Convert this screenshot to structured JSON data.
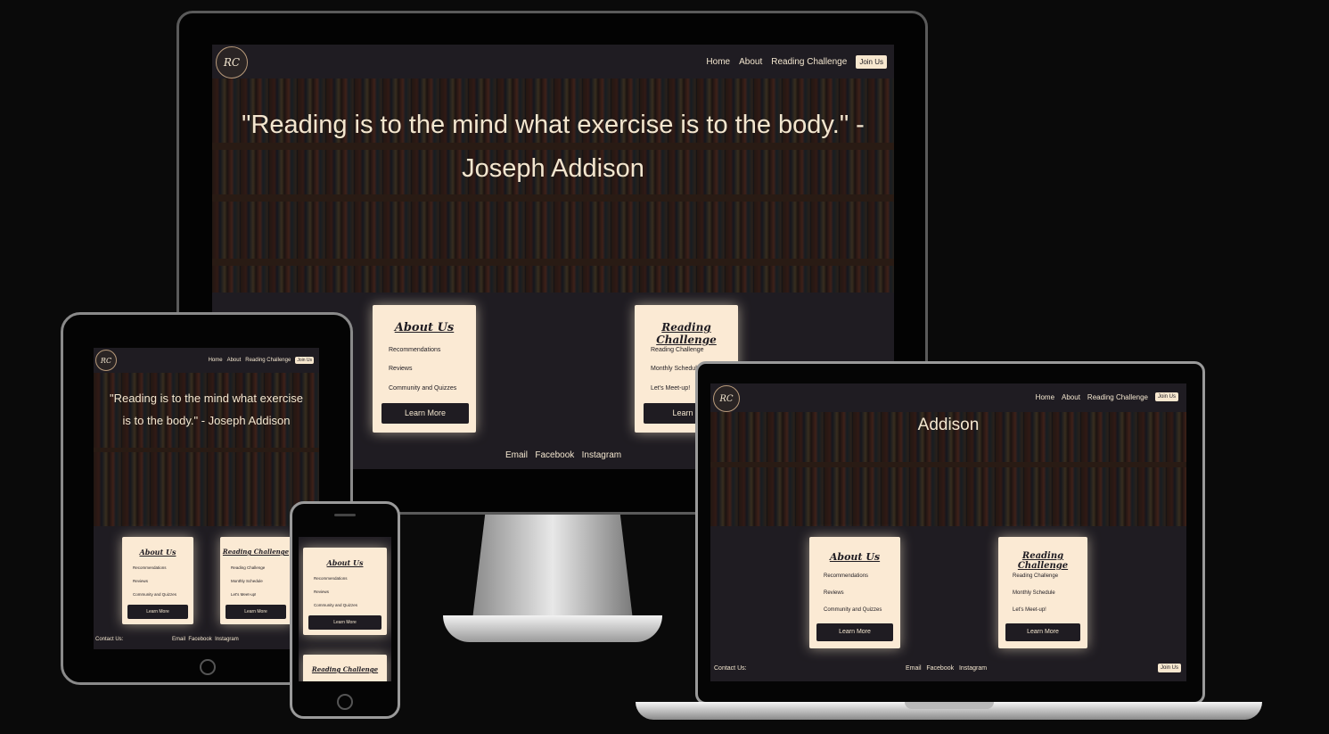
{
  "site": {
    "logo_text": "RC",
    "nav": {
      "home": "Home",
      "about": "About",
      "challenge": "Reading Challenge",
      "join": "Join Us"
    },
    "hero": {
      "quote_line1": "\"Reading is to the mind what exercise is to the body.\" -",
      "quote_line2": "Joseph Addison",
      "tablet_line1": "\"Reading is to the mind what exercise",
      "tablet_line2": "is to the body.\" - Joseph Addison",
      "laptop_text": "Addison"
    },
    "about_card": {
      "title": "About Us",
      "items": [
        "Recommendations",
        "Reviews",
        "Community and Quizzes"
      ],
      "button": "Learn More"
    },
    "challenge_card": {
      "title": "Reading Challenge",
      "items": [
        "Reading Challenge",
        "Monthly Schedule",
        "Let's Meet-up!"
      ],
      "button": "Learn More",
      "button_partial": "Learn M"
    },
    "footer": {
      "contact": "Contact Us:",
      "email": "Email",
      "facebook": "Facebook",
      "instagram": "Instagram",
      "join": "Join Us"
    }
  }
}
